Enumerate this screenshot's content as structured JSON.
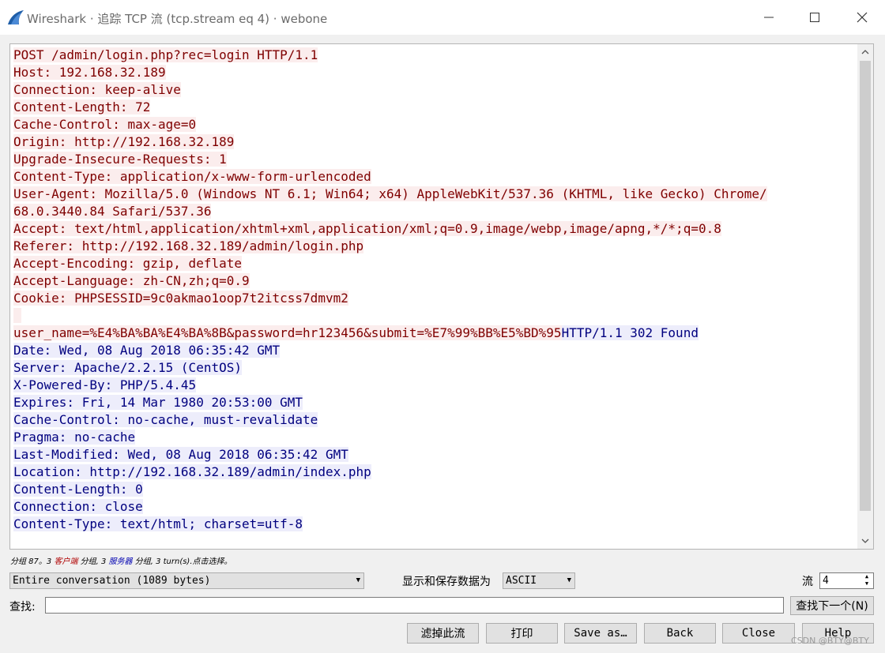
{
  "window": {
    "title": "Wireshark · 追踪 TCP 流 (tcp.stream eq 4) · webone",
    "minimize_icon": "minimize-icon",
    "maximize_icon": "maximize-icon",
    "close_icon": "close-icon"
  },
  "colors": {
    "client_bg": "#fbeded",
    "client_fg": "#7f0000",
    "server_bg": "#ededfb",
    "server_fg": "#00007f"
  },
  "stream_lines": [
    {
      "segments": [
        {
          "side": "client",
          "text": "POST /admin/login.php?rec=login HTTP/1.1"
        }
      ]
    },
    {
      "segments": [
        {
          "side": "client",
          "text": "Host: 192.168.32.189"
        }
      ]
    },
    {
      "segments": [
        {
          "side": "client",
          "text": "Connection: keep-alive"
        }
      ]
    },
    {
      "segments": [
        {
          "side": "client",
          "text": "Content-Length: 72"
        }
      ]
    },
    {
      "segments": [
        {
          "side": "client",
          "text": "Cache-Control: max-age=0"
        }
      ]
    },
    {
      "segments": [
        {
          "side": "client",
          "text": "Origin: http://192.168.32.189"
        }
      ]
    },
    {
      "segments": [
        {
          "side": "client",
          "text": "Upgrade-Insecure-Requests: 1"
        }
      ]
    },
    {
      "segments": [
        {
          "side": "client",
          "text": "Content-Type: application/x-www-form-urlencoded"
        }
      ]
    },
    {
      "segments": [
        {
          "side": "client",
          "text": "User-Agent: Mozilla/5.0 (Windows NT 6.1; Win64; x64) AppleWebKit/537.36 (KHTML, like Gecko) Chrome/"
        }
      ]
    },
    {
      "segments": [
        {
          "side": "client",
          "text": "68.0.3440.84 Safari/537.36"
        }
      ]
    },
    {
      "segments": [
        {
          "side": "client",
          "text": "Accept: text/html,application/xhtml+xml,application/xml;q=0.9,image/webp,image/apng,*/*;q=0.8"
        }
      ]
    },
    {
      "segments": [
        {
          "side": "client",
          "text": "Referer: http://192.168.32.189/admin/login.php"
        }
      ]
    },
    {
      "segments": [
        {
          "side": "client",
          "text": "Accept-Encoding: gzip, deflate"
        }
      ]
    },
    {
      "segments": [
        {
          "side": "client",
          "text": "Accept-Language: zh-CN,zh;q=0.9"
        }
      ]
    },
    {
      "segments": [
        {
          "side": "client",
          "text": "Cookie: PHPSESSID=9c0akmao1oop7t2itcss7dmvm2"
        }
      ]
    },
    {
      "segments": [
        {
          "side": "client",
          "text": " "
        }
      ]
    },
    {
      "segments": [
        {
          "side": "client",
          "text": "user_name=%E4%BA%BA%E4%BA%8B&password=hr123456&submit=%E7%99%BB%E5%BD%95"
        },
        {
          "side": "server",
          "text": "HTTP/1.1 302 Found"
        }
      ]
    },
    {
      "segments": [
        {
          "side": "server",
          "text": "Date: Wed, 08 Aug 2018 06:35:42 GMT"
        }
      ]
    },
    {
      "segments": [
        {
          "side": "server",
          "text": "Server: Apache/2.2.15 (CentOS)"
        }
      ]
    },
    {
      "segments": [
        {
          "side": "server",
          "text": "X-Powered-By: PHP/5.4.45"
        }
      ]
    },
    {
      "segments": [
        {
          "side": "server",
          "text": "Expires: Fri, 14 Mar 1980 20:53:00 GMT"
        }
      ]
    },
    {
      "segments": [
        {
          "side": "server",
          "text": "Cache-Control: no-cache, must-revalidate"
        }
      ]
    },
    {
      "segments": [
        {
          "side": "server",
          "text": "Pragma: no-cache"
        }
      ]
    },
    {
      "segments": [
        {
          "side": "server",
          "text": "Last-Modified: Wed, 08 Aug 2018 06:35:42 GMT"
        }
      ]
    },
    {
      "segments": [
        {
          "side": "server",
          "text": "Location: http://192.168.32.189/admin/index.php"
        }
      ]
    },
    {
      "segments": [
        {
          "side": "server",
          "text": "Content-Length: 0"
        }
      ]
    },
    {
      "segments": [
        {
          "side": "server",
          "text": "Connection: close"
        }
      ]
    },
    {
      "segments": [
        {
          "side": "server",
          "text": "Content-Type: text/html; charset=utf-8"
        }
      ]
    }
  ],
  "summary": {
    "part1": "分组 87。3 ",
    "client": "客户端",
    "part2": " 分组, 3 ",
    "server": "服务器",
    "part3": " 分组, 3 turn(s).点击选择。"
  },
  "controls": {
    "conversation_select": "Entire conversation (1089 bytes)",
    "format_label": "显示和保存数据为",
    "format_select": "ASCII",
    "stream_label": "流",
    "stream_value": "4",
    "find_label": "查找:",
    "find_value": "",
    "find_next": "查找下一个(N)"
  },
  "buttons": {
    "filter_out": "滤掉此流",
    "print": "打印",
    "save_as": "Save as…",
    "back": "Back",
    "close": "Close",
    "help": "Help"
  },
  "watermark": "CSDN @BTY@BTY"
}
